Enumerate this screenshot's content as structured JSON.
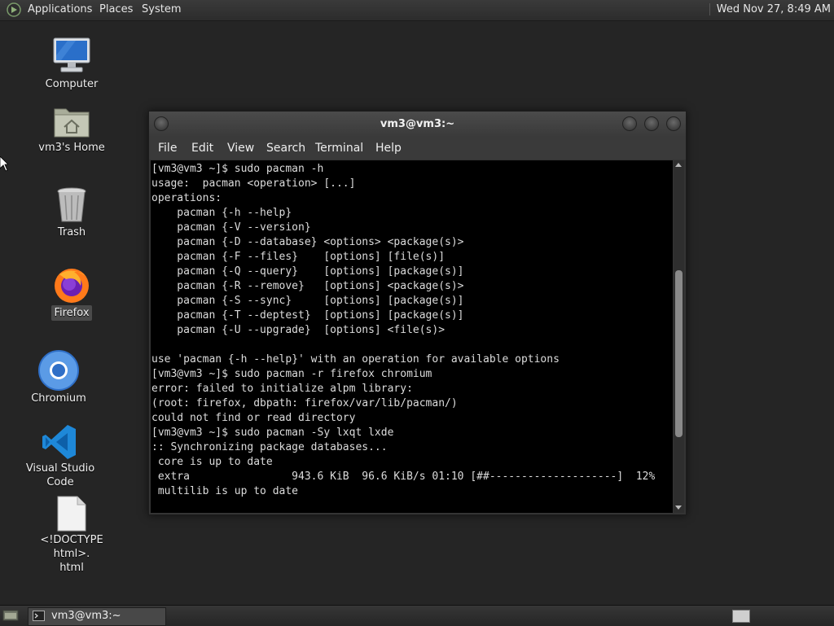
{
  "top_panel": {
    "menus": [
      "Applications",
      "Places",
      "System"
    ],
    "clock": "Wed Nov 27,  8:49 AM"
  },
  "desktop": {
    "icons": [
      {
        "label": "Computer",
        "icon": "computer-icon"
      },
      {
        "label": "vm3's Home",
        "icon": "home-folder-icon"
      },
      {
        "label": "Trash",
        "icon": "trash-icon"
      },
      {
        "label": "Firefox",
        "icon": "firefox-icon",
        "selected": true
      },
      {
        "label": "Chromium",
        "icon": "chromium-icon"
      },
      {
        "label": "Visual Studio Code",
        "icon": "vscode-icon"
      },
      {
        "label": "<!DOCTYPE html>.\nhtml",
        "icon": "file-icon"
      }
    ]
  },
  "window": {
    "title": "vm3@vm3:~",
    "menu": [
      "File",
      "Edit",
      "View",
      "Search",
      "Terminal",
      "Help"
    ],
    "scroll_position": 0.6
  },
  "terminal": {
    "lines": [
      "[vm3@vm3 ~]$ sudo pacman -h",
      "usage:  pacman <operation> [...]",
      "operations:",
      "    pacman {-h --help}",
      "    pacman {-V --version}",
      "    pacman {-D --database} <options> <package(s)>",
      "    pacman {-F --files}    [options] [file(s)]",
      "    pacman {-Q --query}    [options] [package(s)]",
      "    pacman {-R --remove}   [options] <package(s)>",
      "    pacman {-S --sync}     [options] [package(s)]",
      "    pacman {-T --deptest}  [options] [package(s)]",
      "    pacman {-U --upgrade}  [options] <file(s)>",
      "",
      "use 'pacman {-h --help}' with an operation for available options",
      "[vm3@vm3 ~]$ sudo pacman -r firefox chromium",
      "error: failed to initialize alpm library:",
      "(root: firefox, dbpath: firefox/var/lib/pacman/)",
      "could not find or read directory",
      "[vm3@vm3 ~]$ sudo pacman -Sy lxqt lxde",
      ":: Synchronizing package databases...",
      " core is up to date",
      " extra                943.6 KiB  96.6 KiB/s 01:10 [##--------------------]  12%",
      " multilib is up to date"
    ]
  },
  "taskbar": {
    "task_label": "vm3@vm3:~"
  }
}
